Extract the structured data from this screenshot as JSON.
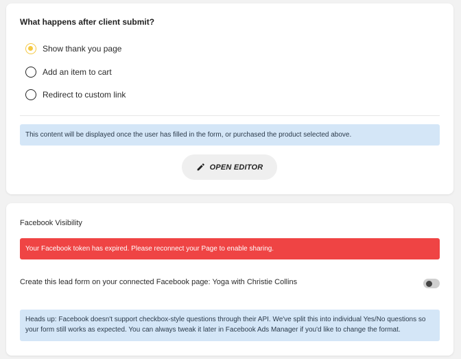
{
  "submit_section": {
    "title": "What happens after client submit?",
    "options": [
      {
        "label": "Show thank you page",
        "selected": true
      },
      {
        "label": "Add an item to cart",
        "selected": false
      },
      {
        "label": "Redirect to custom link",
        "selected": false
      }
    ],
    "info": "This content will be displayed once the user has filled in the form, or purchased the product selected above.",
    "editor_button": "OPEN EDITOR"
  },
  "facebook_section": {
    "title": "Facebook Visibility",
    "error": "Your Facebook token has expired. Please reconnect your Page to enable sharing.",
    "lead_form_label": "Create this lead form on your connected Facebook page: Yoga with Christie Collins",
    "lead_form_enabled": false,
    "info": "Heads up: Facebook doesn't support checkbox-style questions through their API. We've split this into individual Yes/No questions so your form still works as expected. You can always tweak it later in Facebook Ads Manager if you'd like to change the format."
  },
  "colors": {
    "radio_selected": "#f5c842",
    "info_bg": "#d4e6f7",
    "error_bg": "#ef4444",
    "button_bg": "#efefef"
  },
  "icons": {
    "editor_button": "pencil-icon"
  }
}
